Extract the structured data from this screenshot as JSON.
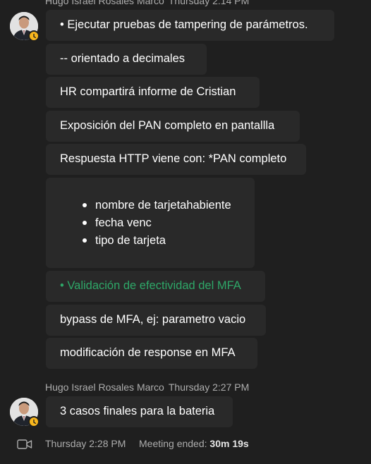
{
  "group1": {
    "sender": "Hugo Israel Rosales Marco",
    "time": "Thursday 2:14 PM",
    "messages": [
      "• Ejecutar pruebas de tampering de parámetros.",
      "-- orientado a decimales",
      "HR compartirá informe de Cristian",
      "Exposición del PAN completo en pantallla",
      "Respuesta HTTP viene con: *PAN completo"
    ],
    "list_items": [
      "nombre de tarjetahabiente",
      "fecha venc",
      "tipo de tarjeta"
    ],
    "highlight": "• Validación de efectividad del MFA",
    "messages2": [
      "bypass de MFA, ej: parametro vacio",
      "modificación de response en MFA"
    ]
  },
  "group2": {
    "sender": "Hugo Israel Rosales Marco",
    "time": "Thursday 2:27 PM",
    "message": "3 casos finales para la bateria"
  },
  "meeting": {
    "time": "Thursday 2:28 PM",
    "label": "Meeting ended: ",
    "duration": "30m 19s",
    "icon": "video-camera-icon"
  },
  "colors": {
    "background": "#1f1f1f",
    "bubble": "#292929",
    "highlight_green": "#2ea768",
    "status_away": "#f8b61d"
  }
}
